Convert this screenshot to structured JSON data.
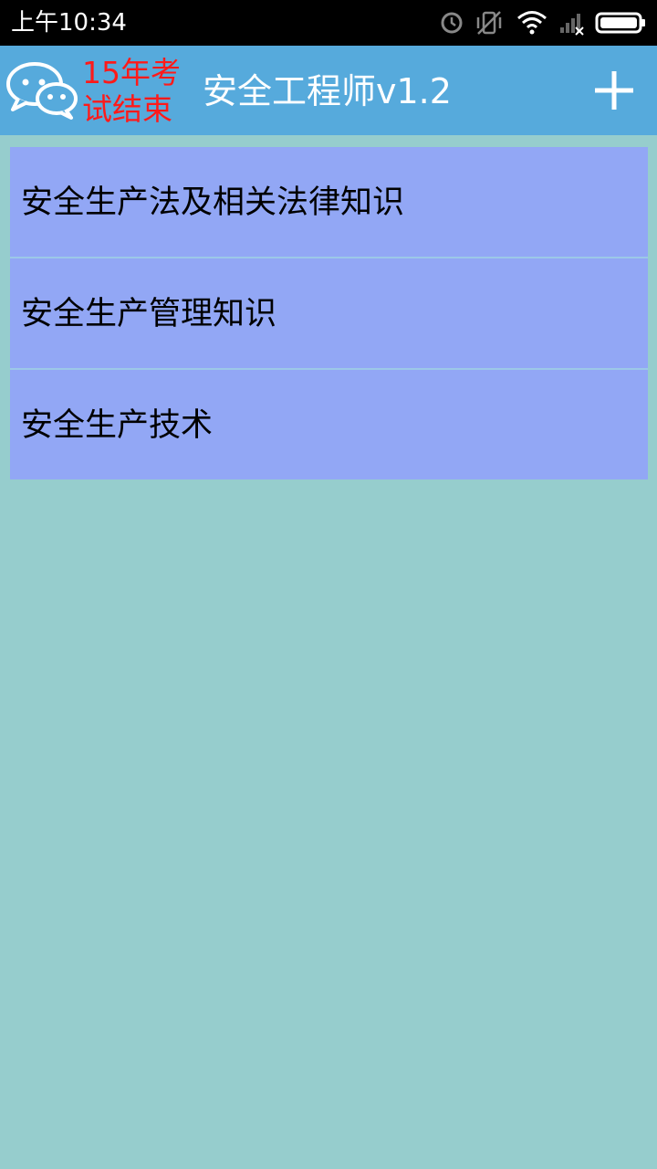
{
  "status_bar": {
    "time": "上午10:34",
    "icons": [
      "alarm-icon",
      "vibrate-off-icon",
      "wifi-icon",
      "signal-no-service-icon",
      "battery-icon"
    ]
  },
  "app_bar": {
    "notice": "15年考试结束",
    "title": "安全工程师v1.2",
    "logo_icon": "chat-bubbles-icon",
    "add_icon": "plus-icon"
  },
  "menu": {
    "items": [
      {
        "label": "安全生产法及相关法律知识"
      },
      {
        "label": "安全生产管理知识"
      },
      {
        "label": "安全生产技术"
      }
    ]
  },
  "colors": {
    "status_bar": "#000000",
    "app_bar": "#56aadc",
    "background": "#96cdcd",
    "list_item": "#92a7f5",
    "notice_text": "#ff1a1a"
  }
}
